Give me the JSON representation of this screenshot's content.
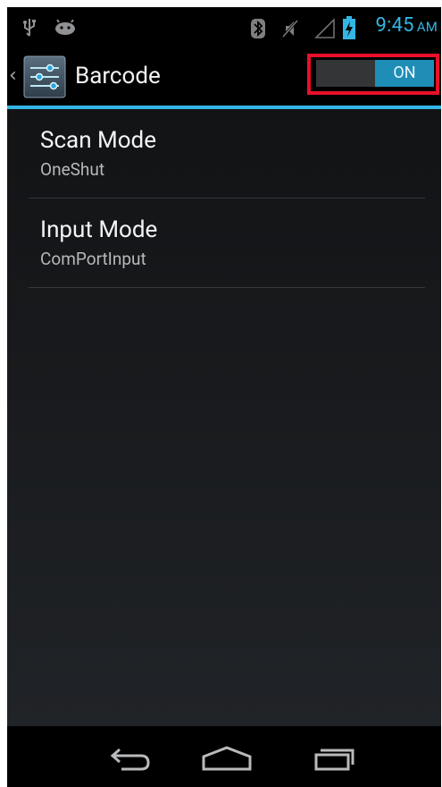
{
  "status_bar": {
    "left_icons": [
      "usb-icon",
      "android-debug-icon"
    ],
    "right_icons": [
      "bluetooth-icon",
      "mute-icon",
      "signal-icon",
      "battery-charging-icon"
    ],
    "time": "9:45",
    "ampm": "AM",
    "accent_color": "#33b5e5"
  },
  "action_bar": {
    "title": "Barcode",
    "switch": {
      "label": "ON",
      "state": "on"
    },
    "highlight_color": "#e8102a"
  },
  "preferences": [
    {
      "title": "Scan Mode",
      "summary": "OneShut"
    },
    {
      "title": "Input Mode",
      "summary": "ComPortInput"
    }
  ],
  "nav_bar": {
    "buttons": [
      "back-icon",
      "home-icon",
      "recent-apps-icon"
    ]
  }
}
